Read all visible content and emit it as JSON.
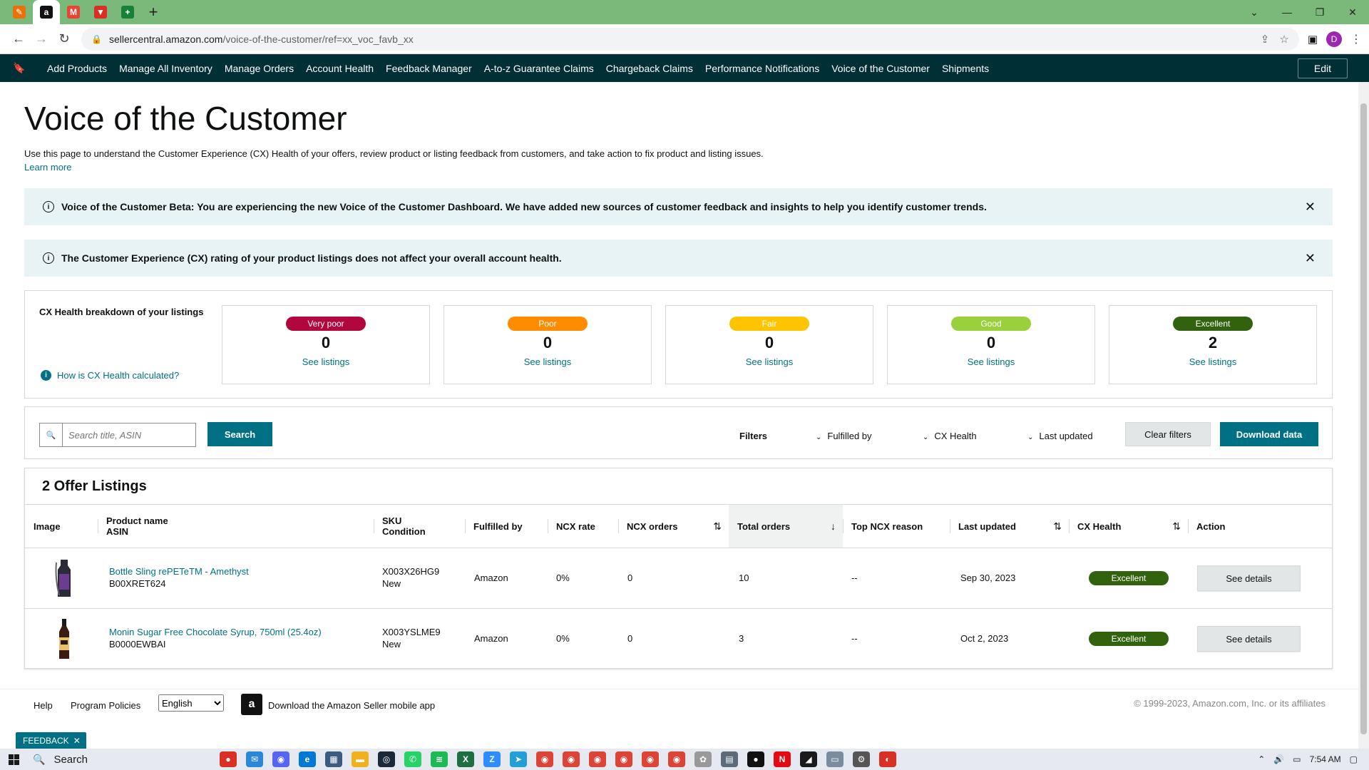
{
  "browser": {
    "tabs": [
      {
        "icon": "multicolor-app-icon",
        "color": "#e8710a",
        "glyph": "✎"
      },
      {
        "icon": "amazon-icon",
        "color": "#111111",
        "glyph": "a"
      },
      {
        "icon": "gmail-icon",
        "color": "#ea4335",
        "glyph": "M"
      },
      {
        "icon": "red-app-icon",
        "color": "#d93025",
        "glyph": "▼"
      },
      {
        "icon": "google-sheets-icon",
        "color": "#188038",
        "glyph": "+"
      }
    ],
    "new_tab": "+",
    "url_host": "sellercentral.amazon.com",
    "url_path": "/voice-of-the-customer/ref=xx_voc_favb_xx",
    "profile_initial": "D"
  },
  "nav": {
    "links": [
      "Add Products",
      "Manage All Inventory",
      "Manage Orders",
      "Account Health",
      "Feedback Manager",
      "A-to-z Guarantee Claims",
      "Chargeback Claims",
      "Performance Notifications",
      "Voice of the Customer",
      "Shipments"
    ],
    "edit_label": "Edit"
  },
  "page": {
    "title": "Voice of the Customer",
    "intro": "Use this page to understand the Customer Experience (CX) Health of your offers, review product or listing feedback from customers, and take action to fix product and listing issues.",
    "learn_more": "Learn more"
  },
  "alerts": [
    {
      "text": "Voice of the Customer Beta: You are experiencing the new Voice of the Customer Dashboard. We have added new sources of customer feedback and insights to help you identify customer trends."
    },
    {
      "text": "The Customer Experience (CX) rating of your product listings does not affect your overall account health."
    }
  ],
  "cx_health": {
    "label": "CX Health breakdown of your listings",
    "how_link": "How is CX Health calculated?",
    "cards": [
      {
        "label": "Very poor",
        "count": "0",
        "link": "See listings",
        "color": "#b2063e"
      },
      {
        "label": "Poor",
        "count": "0",
        "link": "See listings",
        "color": "#ff8c00"
      },
      {
        "label": "Fair",
        "count": "0",
        "link": "See listings",
        "color": "#ffc400"
      },
      {
        "label": "Good",
        "count": "0",
        "link": "See listings",
        "color": "#9ad03b"
      },
      {
        "label": "Excellent",
        "count": "2",
        "link": "See listings",
        "color": "#32620e"
      }
    ]
  },
  "filters": {
    "search_placeholder": "Search title, ASIN",
    "search_button": "Search",
    "filters_label": "Filters",
    "fulfilled_by": "Fulfilled by",
    "cx_health": "CX Health",
    "last_updated": "Last updated",
    "clear_filters": "Clear filters",
    "download": "Download data"
  },
  "listings": {
    "title": "2 Offer Listings",
    "columns": {
      "image": "Image",
      "product_name": "Product name",
      "asin": "ASIN",
      "sku": "SKU",
      "condition": "Condition",
      "fulfilled_by": "Fulfilled by",
      "ncx_rate": "NCX rate",
      "ncx_orders": "NCX orders",
      "total_orders": "Total orders",
      "top_ncx_reason": "Top NCX reason",
      "last_updated": "Last updated",
      "cx_health": "CX Health",
      "action": "Action"
    },
    "rows": [
      {
        "product_name": "Bottle Sling rePETeTM - Amethyst",
        "asin": "B00XRET624",
        "sku": "X003X26HG9",
        "condition": "New",
        "fulfilled_by": "Amazon",
        "ncx_rate": "0%",
        "ncx_orders": "0",
        "total_orders": "10",
        "top_ncx_reason": "--",
        "last_updated": "Sep 30, 2023",
        "cx_health": "Excellent",
        "action": "See details"
      },
      {
        "product_name": "Monin Sugar Free Chocolate Syrup, 750ml (25.4oz)",
        "asin": "B0000EWBAI",
        "sku": "X003YSLME9",
        "condition": "New",
        "fulfilled_by": "Amazon",
        "ncx_rate": "0%",
        "ncx_orders": "0",
        "total_orders": "3",
        "top_ncx_reason": "--",
        "last_updated": "Oct 2, 2023",
        "cx_health": "Excellent",
        "action": "See details"
      }
    ]
  },
  "footer": {
    "help": "Help",
    "program_policies": "Program Policies",
    "language": "English",
    "app_text": "Download the Amazon Seller mobile app",
    "copyright": "© 1999-2023, Amazon.com, Inc. or its affiliates"
  },
  "feedback_tab": "FEEDBACK",
  "taskbar": {
    "search": "Search",
    "time": "7:54 AM"
  }
}
